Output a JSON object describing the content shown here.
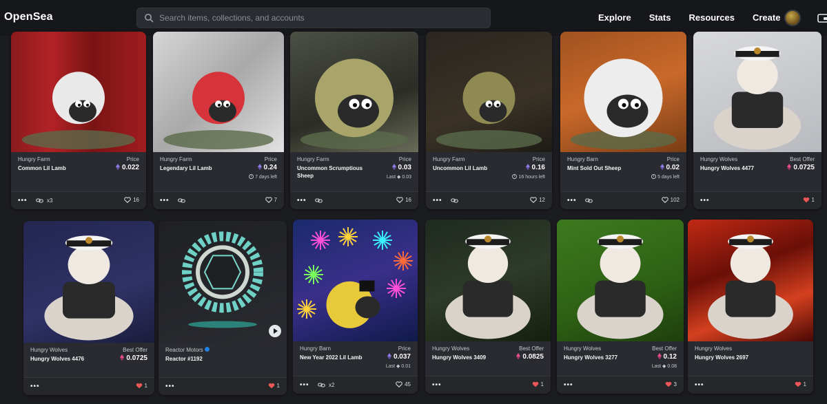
{
  "header": {
    "logo": "OpenSea",
    "search_placeholder": "Search items, collections, and accounts",
    "nav": [
      "Explore",
      "Stats",
      "Resources",
      "Create"
    ]
  },
  "cards": [
    {
      "collection": "Hungry Farm",
      "name": "Common Lil Lamb",
      "price_label": "Price",
      "price": "0.022",
      "sub": "",
      "bundle": "x3",
      "favorites": "16",
      "liked": false
    },
    {
      "collection": "Hungry Farm",
      "name": "Legendary Lil Lamb",
      "price_label": "Price",
      "price": "0.24",
      "sub": "7 days left",
      "bundle": "",
      "favorites": "7",
      "liked": false
    },
    {
      "collection": "Hungry Farm",
      "name": "Uncommon Scrumptious Sheep",
      "price_label": "Price",
      "price": "0.03",
      "sub": "Last ◆ 0.03",
      "bundle": "",
      "favorites": "16",
      "liked": false
    },
    {
      "collection": "Hungry Farm",
      "name": "Uncommon Lil Lamb",
      "price_label": "Price",
      "price": "0.16",
      "sub": "16 hours left",
      "bundle": "",
      "favorites": "12",
      "liked": false
    },
    {
      "collection": "Hungry Barn",
      "name": "Mint Sold Out Sheep",
      "price_label": "Price",
      "price": "0.02",
      "sub": "5 days left",
      "bundle": "",
      "favorites": "102",
      "liked": false
    },
    {
      "collection": "Hungry Wolves",
      "name": "Hungry Wolves 4477",
      "price_label": "Best Offer",
      "price": "0.0725",
      "sub": "",
      "bundle": "",
      "favorites": "1",
      "liked": true
    },
    {
      "collection": "Hungry Wolves",
      "name": "Hungry Wolves 4476",
      "price_label": "Best Offer",
      "price": "0.0725",
      "sub": "",
      "bundle": "",
      "favorites": "1",
      "liked": true
    },
    {
      "collection": "Reactor Motors",
      "name": "Reactor #1192",
      "price_label": "",
      "price": "",
      "sub": "",
      "bundle": "",
      "favorites": "1",
      "liked": true
    },
    {
      "collection": "Hungry Barn",
      "name": "New Year 2022 Lil Lamb",
      "price_label": "Price",
      "price": "0.037",
      "sub": "Last ◆ 0.01",
      "bundle": "x2",
      "favorites": "45",
      "liked": false
    },
    {
      "collection": "Hungry Wolves",
      "name": "Hungry Wolves 3409",
      "price_label": "Best Offer",
      "price": "0.0825",
      "sub": "",
      "bundle": "",
      "favorites": "1",
      "liked": true
    },
    {
      "collection": "Hungry Wolves",
      "name": "Hungry Wolves 3277",
      "price_label": "Best Offer",
      "price": "0.12",
      "sub": "Last ◆ 0.08",
      "bundle": "",
      "favorites": "3",
      "liked": true
    },
    {
      "collection": "Hungry Wolves",
      "name": "Hungry Wolves 2697",
      "price_label": "",
      "price": "",
      "sub": "",
      "bundle": "",
      "favorites": "1",
      "liked": true
    }
  ],
  "colors": {
    "accent": "#2081e2",
    "heart_liked": "#eb5757",
    "eth_purple": "#8c7ae6",
    "weth_pink": "#ec4c8c"
  },
  "icons": [
    "search-icon",
    "avatar",
    "wallet-icon",
    "more-dots-icon",
    "link-icon",
    "heart-icon",
    "eth-icon",
    "clock-icon",
    "play-icon",
    "verified-icon"
  ]
}
